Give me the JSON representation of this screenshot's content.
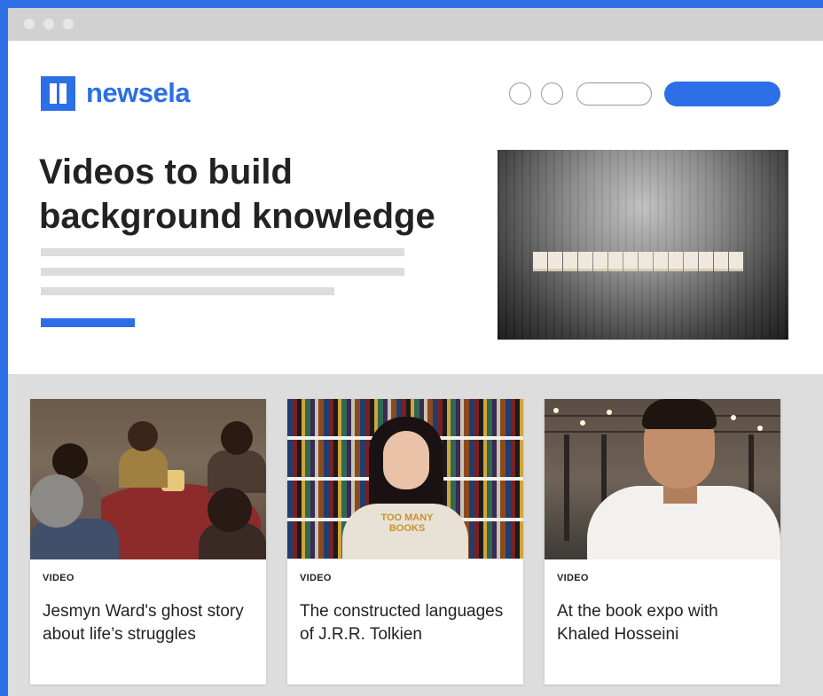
{
  "brand": {
    "name": "newsela",
    "color": "#2c6fe6"
  },
  "hero": {
    "title_line1": "Videos to build",
    "title_line2": "background knowledge"
  },
  "cards": [
    {
      "label": "VIDEO",
      "title": "Jesmyn Ward's ghost story about life’s struggles"
    },
    {
      "label": "VIDEO",
      "title": "The constructed languages of J.R.R. Tolkien",
      "shirt_text": "TOO MANY BOOKS"
    },
    {
      "label": "VIDEO",
      "title": "At the book expo with Khaled Hosseini"
    }
  ],
  "icons": {
    "browser_dots": [
      "window-dot-icon",
      "window-dot-icon",
      "window-dot-icon"
    ],
    "logo": "newsela-logo-icon"
  }
}
